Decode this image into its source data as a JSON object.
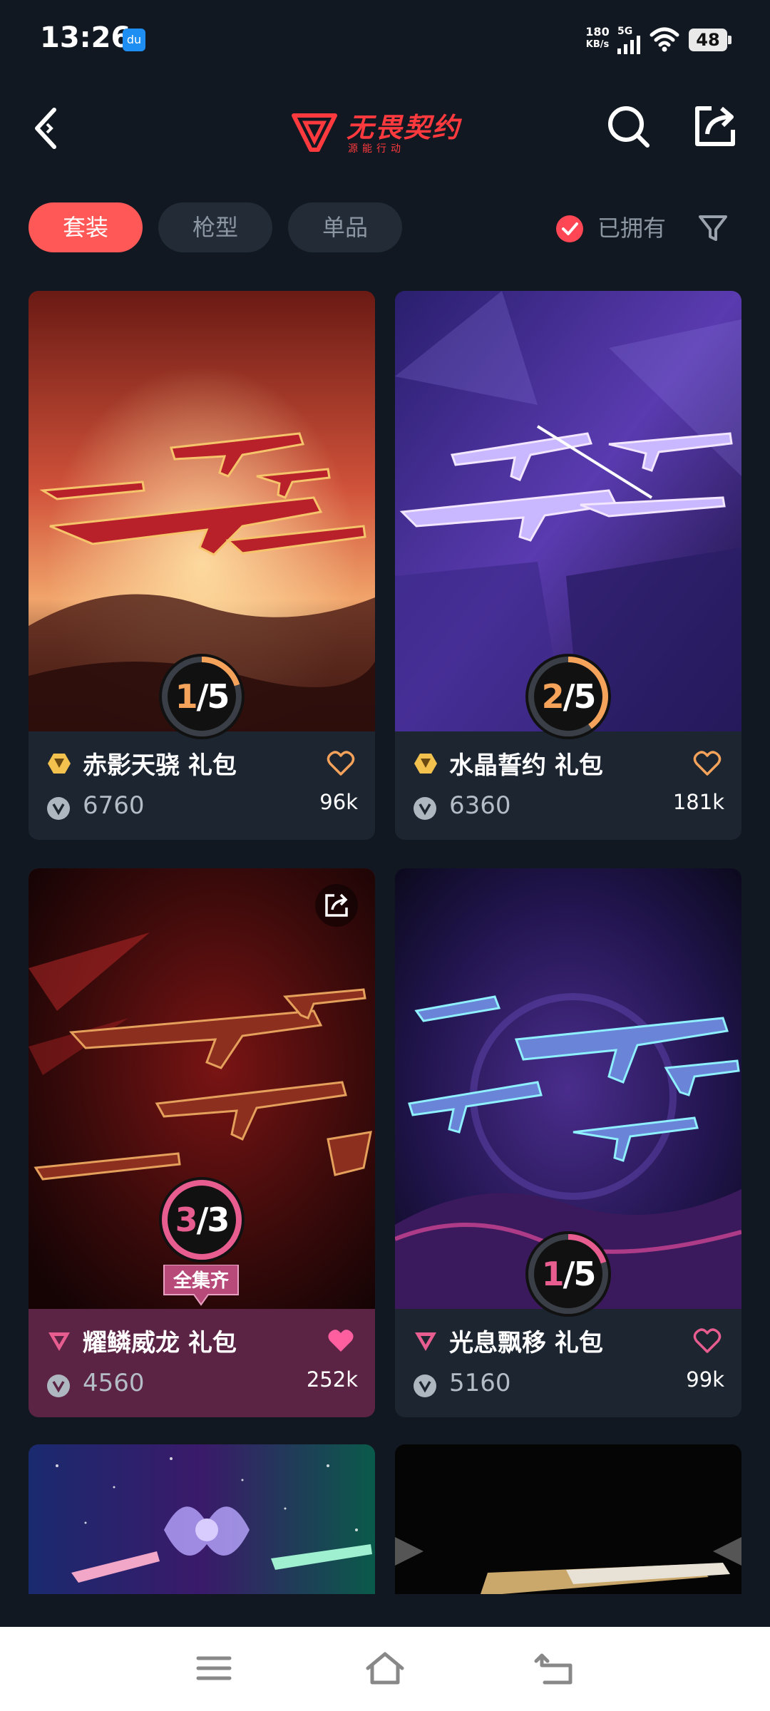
{
  "status": {
    "time": "13:26",
    "net_speed_value": "180",
    "net_speed_unit": "KB/s",
    "signal": "5G",
    "battery": "48"
  },
  "header": {
    "logo_title": "无畏契约",
    "logo_subtitle": "源能行动"
  },
  "filters": {
    "tabs": [
      {
        "label": "套装",
        "active": true
      },
      {
        "label": "枪型",
        "active": false
      },
      {
        "label": "单品",
        "active": false
      }
    ],
    "owned_label": "已拥有"
  },
  "cards": [
    {
      "name": "赤影天骁 礼包",
      "tier": "gold",
      "price": "6760",
      "likes": "96k",
      "progress_owned": "1",
      "progress_total": "5",
      "liked": false
    },
    {
      "name": "水晶誓约 礼包",
      "tier": "gold",
      "price": "6360",
      "likes": "181k",
      "progress_owned": "2",
      "progress_total": "5",
      "liked": false
    },
    {
      "name": "耀鳞威龙 礼包",
      "tier": "pink",
      "price": "4560",
      "likes": "252k",
      "progress_owned": "3",
      "progress_total": "3",
      "liked": true,
      "badge": "全集齐"
    },
    {
      "name": "光息飘移 礼包",
      "tier": "pink",
      "price": "5160",
      "likes": "99k",
      "progress_owned": "1",
      "progress_total": "5",
      "liked": false
    }
  ],
  "colors": {
    "accent": "#ff5857",
    "progress_orange": "#f5a25b",
    "progress_pink": "#e85d8f",
    "background": "#111821"
  }
}
